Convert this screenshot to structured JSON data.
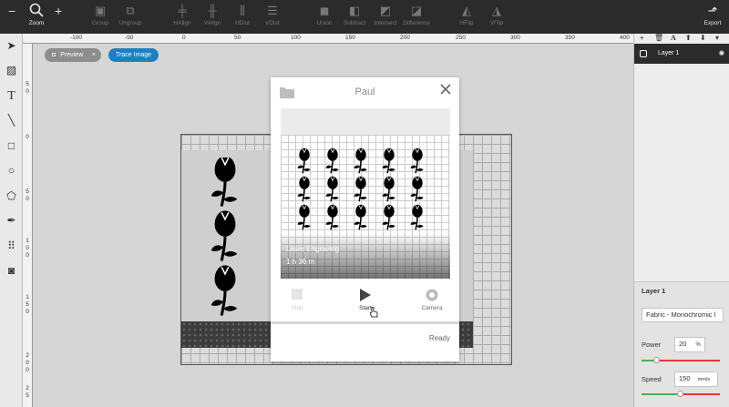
{
  "toolbar": {
    "zoom": "Zoom",
    "group": "Group",
    "ungroup": "Ungroup",
    "halign": "HAlign",
    "valign": "VAlign",
    "hdist": "HDist",
    "vdist": "VDist",
    "union": "Union",
    "subtract": "Subtract",
    "intersect": "Intersect",
    "difference": "Difference",
    "hflip": "HFlip",
    "vflip": "VFlip",
    "export": "Export"
  },
  "ruler_top": [
    "-100",
    "-50",
    "0",
    "50",
    "100",
    "150",
    "200",
    "250",
    "300",
    "350",
    "400"
  ],
  "ruler_left": [
    "5",
    "0",
    "0",
    "5",
    "0",
    "1",
    "0",
    "0",
    "1",
    "5",
    "0",
    "2",
    "0",
    "0",
    "2",
    "5"
  ],
  "canvas": {
    "preview_chip": "Preview",
    "preview_close": "×",
    "trace_chip": "Trace Image"
  },
  "layers_panel": {
    "layer_name": "Layer 1"
  },
  "properties": {
    "title": "Layer 1",
    "material": "Fabric - Monochromic l",
    "power_label": "Power",
    "power_value": "20",
    "power_unit": "%",
    "power_level": 0.2,
    "speed_label": "Speed",
    "speed_value": "150",
    "speed_unit": "mm/s",
    "speed_level": 0.5
  },
  "dialog": {
    "machine_name": "Paul",
    "job_name": "Laser Engraving",
    "job_time": "1 h 36 m",
    "stop_label": "Stop",
    "start_label": "Start",
    "camera_label": "Camera",
    "status": "Ready"
  },
  "colors": {
    "toolbar_bg": "#2b2b2b",
    "accent": "#1a82c4",
    "slider_green": "#4caf50",
    "slider_red": "#e53935"
  }
}
